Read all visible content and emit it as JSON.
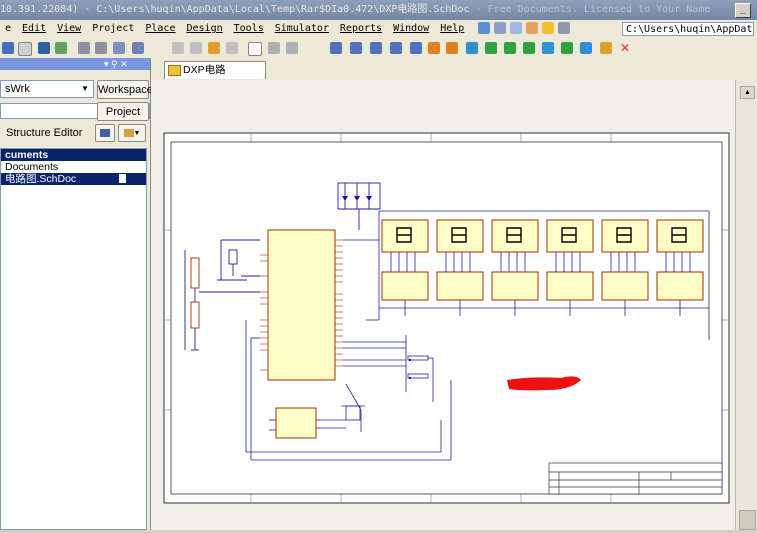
{
  "window": {
    "title_left": "10.391.22084) - C:\\Users\\huqin\\AppData\\Local\\Temp\\Rar$DIa0.472\\DXP电路图.SchDoc",
    "title_right": " - Free Documents. Licensed to Your Name",
    "min_glyph": "_"
  },
  "menu": {
    "items": [
      {
        "label": "e"
      },
      {
        "label": "Edit"
      },
      {
        "label": "View"
      },
      {
        "label": "Project"
      },
      {
        "label": "Place"
      },
      {
        "label": "Design"
      },
      {
        "label": "Tools"
      },
      {
        "label": "Simulator"
      },
      {
        "label": "Reports"
      },
      {
        "label": "Window"
      },
      {
        "label": "Help"
      }
    ],
    "path_value": "C:\\Users\\huqin\\AppData\\"
  },
  "panel": {
    "header_controls": "▾ ⚲ ✕",
    "workspace_combo": "sWrk",
    "workspace_button": "Workspace",
    "project_button": "Project",
    "structure_editor_label": "Structure Editor",
    "tree": {
      "header": "cuments",
      "item1": "Documents",
      "item2": "电路图.SchDoc"
    }
  },
  "document_tab": {
    "label": "DXP电路图.SchDoc"
  },
  "colors": {
    "titlebar": "#7386a3",
    "selection": "#0a246a",
    "wire": "#2020a0",
    "component_fill": "#ffffc8",
    "component_border": "#a03000",
    "red_mark": "#ee1111"
  }
}
